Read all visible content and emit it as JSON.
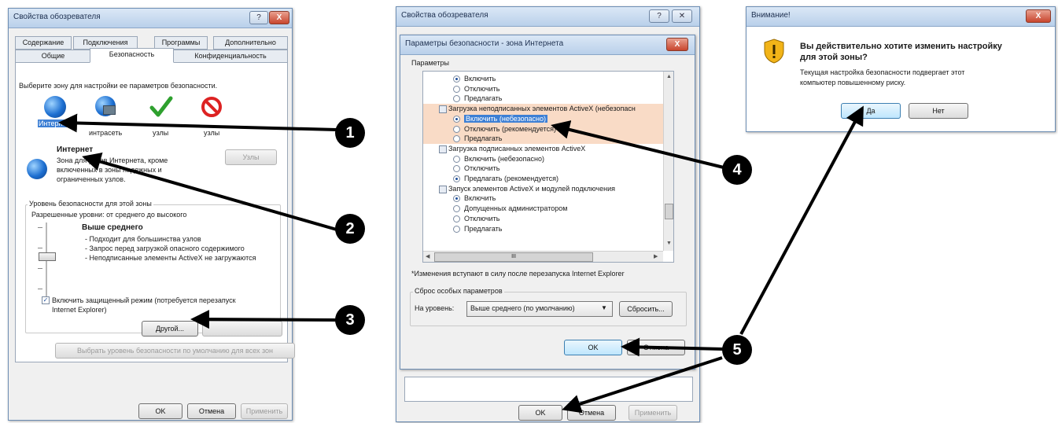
{
  "window1": {
    "title": "Свойства обозревателя",
    "help_btn": "?",
    "close_btn": "X",
    "tabs_row1": [
      "Содержание",
      "Подключения",
      "Программы",
      "Дополнительно"
    ],
    "tabs_row2": [
      "Общие",
      "Безопасность",
      "Конфиденциальность"
    ],
    "zone_prompt": "Выберите зону для настройки ее параметров безопасности.",
    "zones": [
      "Интернет",
      "Местная интрасеть",
      "Надежные узлы",
      "Опасные узлы"
    ],
    "zones_visible": [
      "Интерне",
      "интрасеть",
      "узлы",
      "узлы"
    ],
    "zone_title": "Интернет",
    "zone_desc": [
      "Зона для узлов Интернета, кроме",
      "включенных в зоны надежных и",
      "ограниченных узлов."
    ],
    "sites_button": "Узлы",
    "group_label": "Уровень безопасности для этой зоны",
    "allowed_levels": "Разрешенные уровни: от среднего до высокого",
    "level_title": "Выше среднего",
    "level_items": [
      "- Подходит для большинства узлов",
      "- Запрос перед загрузкой опасного содержимого",
      "- Неподписанные элементы ActiveX не загружаются"
    ],
    "protected_mode": [
      "Включить защищенный режим (потребуется перезапуск",
      "Internet Explorer)"
    ],
    "custom_button": "Другой...",
    "default_all_button": "Выбрать уровень безопасности по умолчанию для всех зон",
    "ok": "OK",
    "cancel": "Отмена",
    "apply": "Применить"
  },
  "window2_back": {
    "title": "Свойства обозревателя",
    "ok": "OK",
    "cancel": "Отмена",
    "apply": "Применить"
  },
  "window2": {
    "title": "Параметры безопасности - зона Интернета",
    "close_btn": "X",
    "params_label": "Параметры",
    "list": [
      {
        "type": "radio",
        "on": true,
        "text": "Включить"
      },
      {
        "type": "radio",
        "on": false,
        "text": "Отключить"
      },
      {
        "type": "radio",
        "on": false,
        "text": "Предлагать"
      },
      {
        "type": "header",
        "text": "Загрузка неподписанных элементов ActiveX (небезопасн"
      },
      {
        "type": "radio",
        "on": true,
        "text": "Включить (небезопасно)"
      },
      {
        "type": "radio",
        "on": false,
        "text": "Отключить (рекомендуется)"
      },
      {
        "type": "radio",
        "on": false,
        "text": "Предлагать"
      },
      {
        "type": "header",
        "text": "Загрузка подписанных элементов ActiveX"
      },
      {
        "type": "radio",
        "on": false,
        "text": "Включить (небезопасно)"
      },
      {
        "type": "radio",
        "on": false,
        "text": "Отключить"
      },
      {
        "type": "radio",
        "on": true,
        "text": "Предлагать (рекомендуется)"
      },
      {
        "type": "header",
        "text": "Запуск элементов ActiveX и модулей подключения"
      },
      {
        "type": "radio",
        "on": true,
        "text": "Включить"
      },
      {
        "type": "radio",
        "on": false,
        "text": "Допущенных администратором"
      },
      {
        "type": "radio",
        "on": false,
        "text": "Отключить"
      },
      {
        "type": "radio",
        "on": false,
        "text": "Предлагать"
      }
    ],
    "hscroll_mid": "III",
    "restart_note": "*Изменения вступают в силу после перезапуска Internet Explorer",
    "reset_group": "Сброс особых параметров",
    "reset_to": "На уровень:",
    "reset_select": "Выше среднего (по умолчанию)",
    "reset_button": "Сбросить...",
    "ok": "OK",
    "cancel": "Отмена"
  },
  "window3": {
    "title": "Внимание!",
    "close_btn": "X",
    "question": [
      "Вы действительно хотите изменить настройку",
      "для этой зоны?"
    ],
    "detail": [
      "Текущая настройка безопасности подвергает этот",
      "компьютер повышенному риску."
    ],
    "yes": "Да",
    "no": "Нет"
  },
  "callouts": [
    "1",
    "2",
    "3",
    "4",
    "5"
  ],
  "colors": {
    "arrow": "#000000",
    "highlight": "#f9dbc6",
    "selection": "#3d7fd4",
    "title_gradient": "#b9d0ea"
  }
}
